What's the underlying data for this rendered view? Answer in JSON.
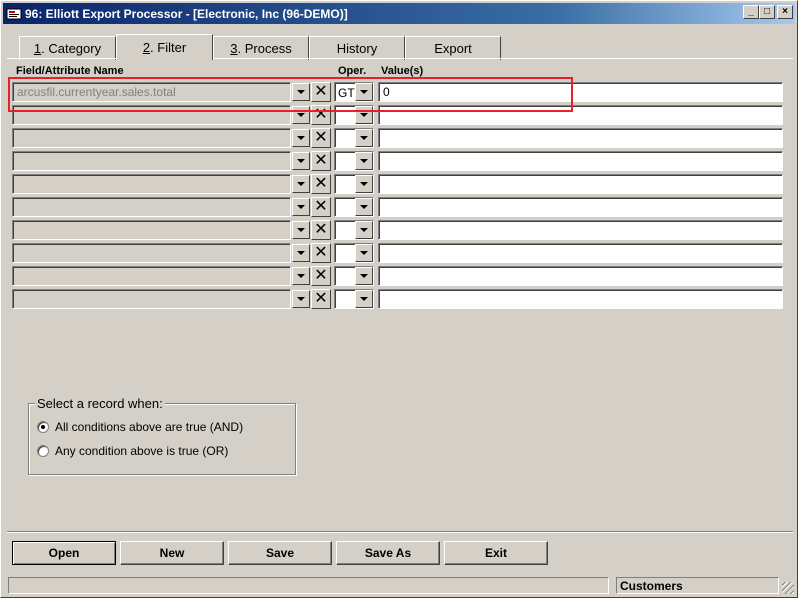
{
  "window": {
    "title": "96: Elliott Export Processor - [Electronic, Inc (96-DEMO)]",
    "minimize": "_",
    "maximize": "□",
    "close": "×"
  },
  "tabs": [
    {
      "prefix": "1",
      "label": ". Category"
    },
    {
      "prefix": "2",
      "label": ". Filter"
    },
    {
      "prefix": "3",
      "label": ". Process"
    },
    {
      "prefix": "",
      "label": "History"
    },
    {
      "prefix": "",
      "label": "Export"
    }
  ],
  "active_tab": "2. Filter",
  "columns": {
    "field": "Field/Attribute Name",
    "oper": "Oper.",
    "value": "Value(s)"
  },
  "rows": [
    {
      "field": "arcusfil.currentyear.sales.total",
      "oper": "GT",
      "value": "0"
    },
    {
      "field": "",
      "oper": "",
      "value": ""
    },
    {
      "field": "",
      "oper": "",
      "value": ""
    },
    {
      "field": "",
      "oper": "",
      "value": ""
    },
    {
      "field": "",
      "oper": "",
      "value": ""
    },
    {
      "field": "",
      "oper": "",
      "value": ""
    },
    {
      "field": "",
      "oper": "",
      "value": ""
    },
    {
      "field": "",
      "oper": "",
      "value": ""
    },
    {
      "field": "",
      "oper": "",
      "value": ""
    },
    {
      "field": "",
      "oper": "",
      "value": ""
    }
  ],
  "select_group": {
    "title": "Select a record when:",
    "options": [
      {
        "label": "All conditions above are true (AND)",
        "checked": true
      },
      {
        "label": "Any condition above is true (OR)",
        "checked": false
      }
    ]
  },
  "buttons": [
    {
      "label": "Open",
      "u": "O"
    },
    {
      "label": "New",
      "u": "N"
    },
    {
      "label": "Save",
      "u": "S"
    },
    {
      "label": "Save As",
      "u": "A"
    },
    {
      "label": "Exit",
      "u": "x"
    }
  ],
  "status": {
    "left": "",
    "right": "Customers"
  },
  "colors": {
    "title_bar": "#0a246a",
    "highlight": "#e8202a",
    "face": "#d4d0c8"
  },
  "icons": {
    "app": "app-icon",
    "dropdown": "chevron-down-icon",
    "clear": "close-icon"
  }
}
